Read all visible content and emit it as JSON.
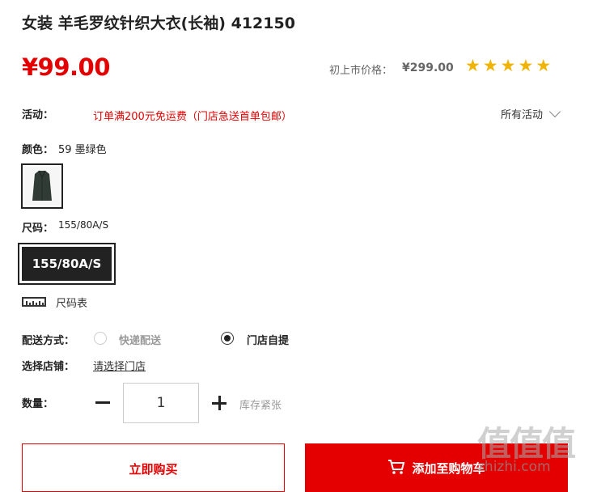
{
  "product": {
    "title": "女装 羊毛罗纹针织大衣(长袖) 412150",
    "price": "¥99.00",
    "original_price_label": "初上市价格：",
    "original_price": "¥299.00",
    "rating_stars": 5
  },
  "activity": {
    "label": "活动：",
    "promo_text": "订单满200元免运费（门店急送首单包邮）",
    "all_label": "所有活动"
  },
  "color": {
    "label": "颜色：",
    "value": "59 墨绿色",
    "swatch_color": "#2f3b34"
  },
  "size": {
    "label": "尺码：",
    "value": "155/80A/S",
    "options": [
      "155/80A/S"
    ],
    "chart_label": "尺码表"
  },
  "delivery": {
    "label": "配送方式：",
    "options": [
      {
        "label": "快递配送",
        "selected": false
      },
      {
        "label": "门店自提",
        "selected": true
      }
    ]
  },
  "store": {
    "label": "选择店铺：",
    "link_text": "请选择门店"
  },
  "quantity": {
    "label": "数量：",
    "value": "1",
    "stock_text": "库存紧张"
  },
  "actions": {
    "buy_now": "立即购买",
    "add_to_cart": "添加至购物车"
  },
  "watermark": {
    "logo": "值值值",
    "domain": "zhizhi.com"
  },
  "colors": {
    "accent": "#e40000",
    "star": "#f0b400"
  }
}
